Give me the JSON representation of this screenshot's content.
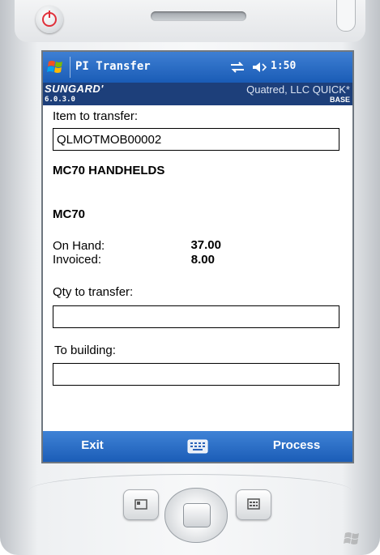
{
  "titlebar": {
    "app_title": "PI Transfer",
    "clock": "1:50"
  },
  "brandbar": {
    "brand": "SUNGARD'",
    "company": "Quatred, LLC  QUICK*",
    "version": "6.0.3.0",
    "environment": "BASE"
  },
  "form": {
    "item_label": "Item to transfer:",
    "item_value": "QLMOTMOB00002",
    "description": "MC70 HANDHELDS",
    "model": "MC70",
    "on_hand_label": "On Hand:",
    "on_hand_value": "37.00",
    "invoiced_label": "Invoiced:",
    "invoiced_value": "8.00",
    "qty_label": "Qty to transfer:",
    "qty_value": "",
    "building_label": "To building:",
    "building_value": ""
  },
  "softkeys": {
    "left": "Exit",
    "right": "Process"
  },
  "colors": {
    "titlebar": "#1a5cb6",
    "brandbar": "#1d3f7a",
    "power": "#e0303a"
  },
  "icons": [
    "power-icon",
    "windows-flag-icon",
    "sync-icon",
    "volume-icon",
    "keyboard-icon",
    "dpad-icon"
  ]
}
